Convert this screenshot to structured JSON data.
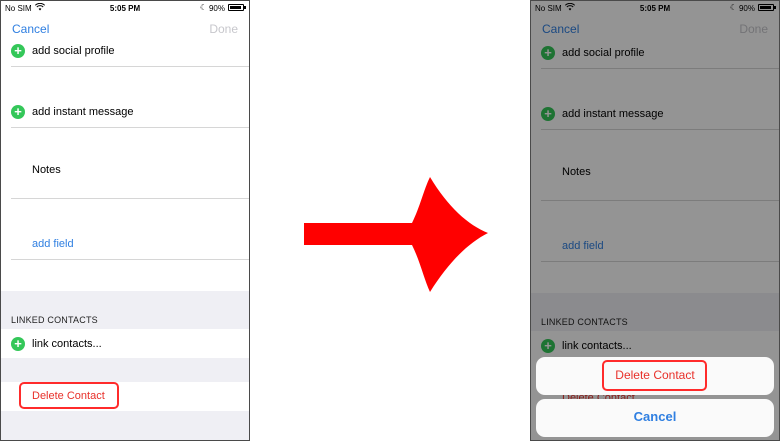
{
  "status_bar": {
    "carrier": "No SIM",
    "time": "5:05 PM",
    "battery_percent": "90%",
    "battery_level": 0.9,
    "icons": [
      "wifi-icon",
      "moon-icon",
      "battery-icon"
    ]
  },
  "nav": {
    "cancel_label": "Cancel",
    "done_label": "Done"
  },
  "rows": {
    "social_profile": "add social profile",
    "instant_message": "add instant message",
    "notes": "Notes",
    "add_field": "add field",
    "linked_contacts_header": "LINKED CONTACTS",
    "link_contacts": "link contacts...",
    "delete_contact": "Delete Contact"
  },
  "action_sheet": {
    "delete_label": "Delete Contact",
    "cancel_label": "Cancel"
  },
  "colors": {
    "accent_blue": "#2f7fe1",
    "destructive_red": "#e8302a",
    "add_green": "#34c759",
    "highlight_red": "#ff2b2b",
    "arrow_red": "#ff0000"
  }
}
